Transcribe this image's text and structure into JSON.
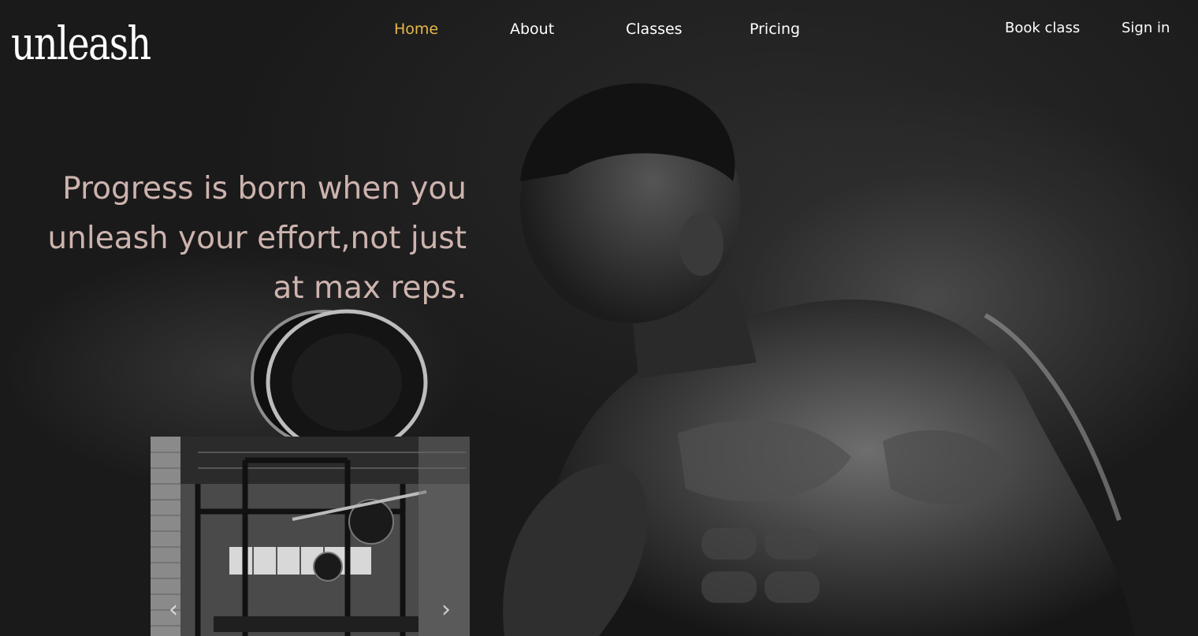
{
  "brand": {
    "logo_text": "unleash"
  },
  "nav": {
    "items": [
      {
        "label": "Home",
        "active": true
      },
      {
        "label": "About",
        "active": false
      },
      {
        "label": "Classes",
        "active": false
      },
      {
        "label": "Pricing",
        "active": false
      }
    ],
    "book_class": "Book class",
    "sign_in": "Sign in"
  },
  "hero": {
    "quote_lines": [
      "Progress is born when you",
      "unleash your effort,not just",
      "at max reps."
    ]
  },
  "gallery": {
    "prev_icon": "chevron-left-icon",
    "next_icon": "chevron-right-icon"
  },
  "colors": {
    "active_nav": "#e6b84a",
    "quote_text": "#cdb3ae",
    "background": "#1b1b1b"
  }
}
